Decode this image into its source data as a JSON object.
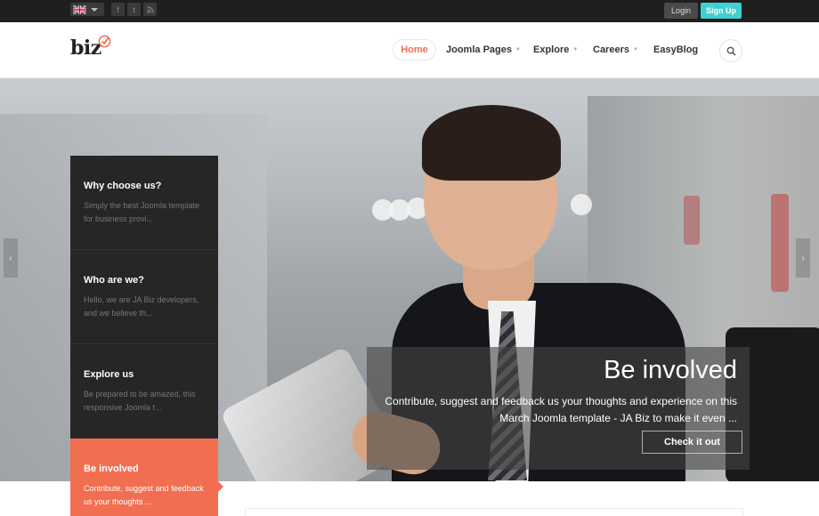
{
  "topbar": {
    "language_flag": "uk-flag-icon",
    "social_icons": [
      "facebook-icon",
      "twitter-icon",
      "rss-icon"
    ],
    "login_label": "Login",
    "signup_label": "Sign Up",
    "signup_color": "#3fd1d1"
  },
  "header": {
    "logo_text": "biz",
    "nav": [
      {
        "label": "Home",
        "active": true
      },
      {
        "label": "Joomla Pages",
        "dropdown": true
      },
      {
        "label": "Explore",
        "dropdown": true
      },
      {
        "label": "Careers",
        "dropdown": true
      },
      {
        "label": "EasyBlog"
      }
    ],
    "accent_color": "#f36f4f"
  },
  "hero": {
    "caption": {
      "title": "Be involved",
      "text": "Contribute, suggest and feedback us your thoughts and experience on this March Joomla template - JA Biz to make it even ...",
      "button_label": "Check it out"
    },
    "tabs": [
      {
        "title": "Why choose us?",
        "desc": "Simply the best Joomla template for business provi..."
      },
      {
        "title": "Who are we?",
        "desc": "Hello, we are JA Biz developers, and we believe th..."
      },
      {
        "title": "Explore us",
        "desc": "Be prepared to be amazed, this responsive Joomla t..."
      },
      {
        "title": "Be involved",
        "desc": "Contribute, suggest and feedback us your thoughts ...",
        "active": true
      }
    ],
    "prev_icon": "‹",
    "next_icon": "›"
  }
}
